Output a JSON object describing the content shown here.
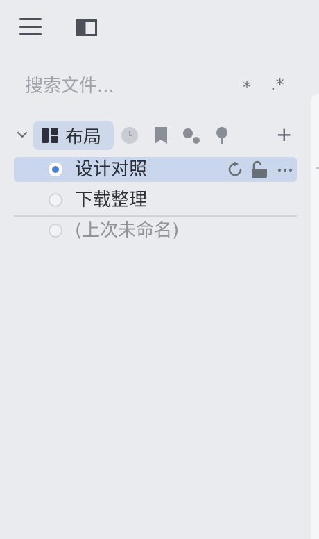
{
  "search": {
    "placeholder": "搜索文件...",
    "option_glob": "*",
    "option_regex": ".*"
  },
  "group": {
    "title": "布局",
    "add_label": "+"
  },
  "items": [
    {
      "label": "设计对照",
      "selected": true
    },
    {
      "label": "下载整理",
      "selected": false
    },
    {
      "label": "(上次未命名)",
      "selected": false
    }
  ],
  "icons": {
    "menu": "hamburger-menu-icon",
    "panel": "panel-toggle-icon",
    "layout": "layout-grid-icon",
    "history": "clock-icon",
    "bookmark": "bookmark-icon",
    "nodes": "nodes-icon",
    "pin": "pin-icon",
    "refresh": "refresh-icon",
    "unlock": "unlock-icon",
    "more": "more-icon"
  },
  "colors": {
    "background": "#e9ebef",
    "selection": "#c9d6ec",
    "accent": "#4a7fd8"
  }
}
